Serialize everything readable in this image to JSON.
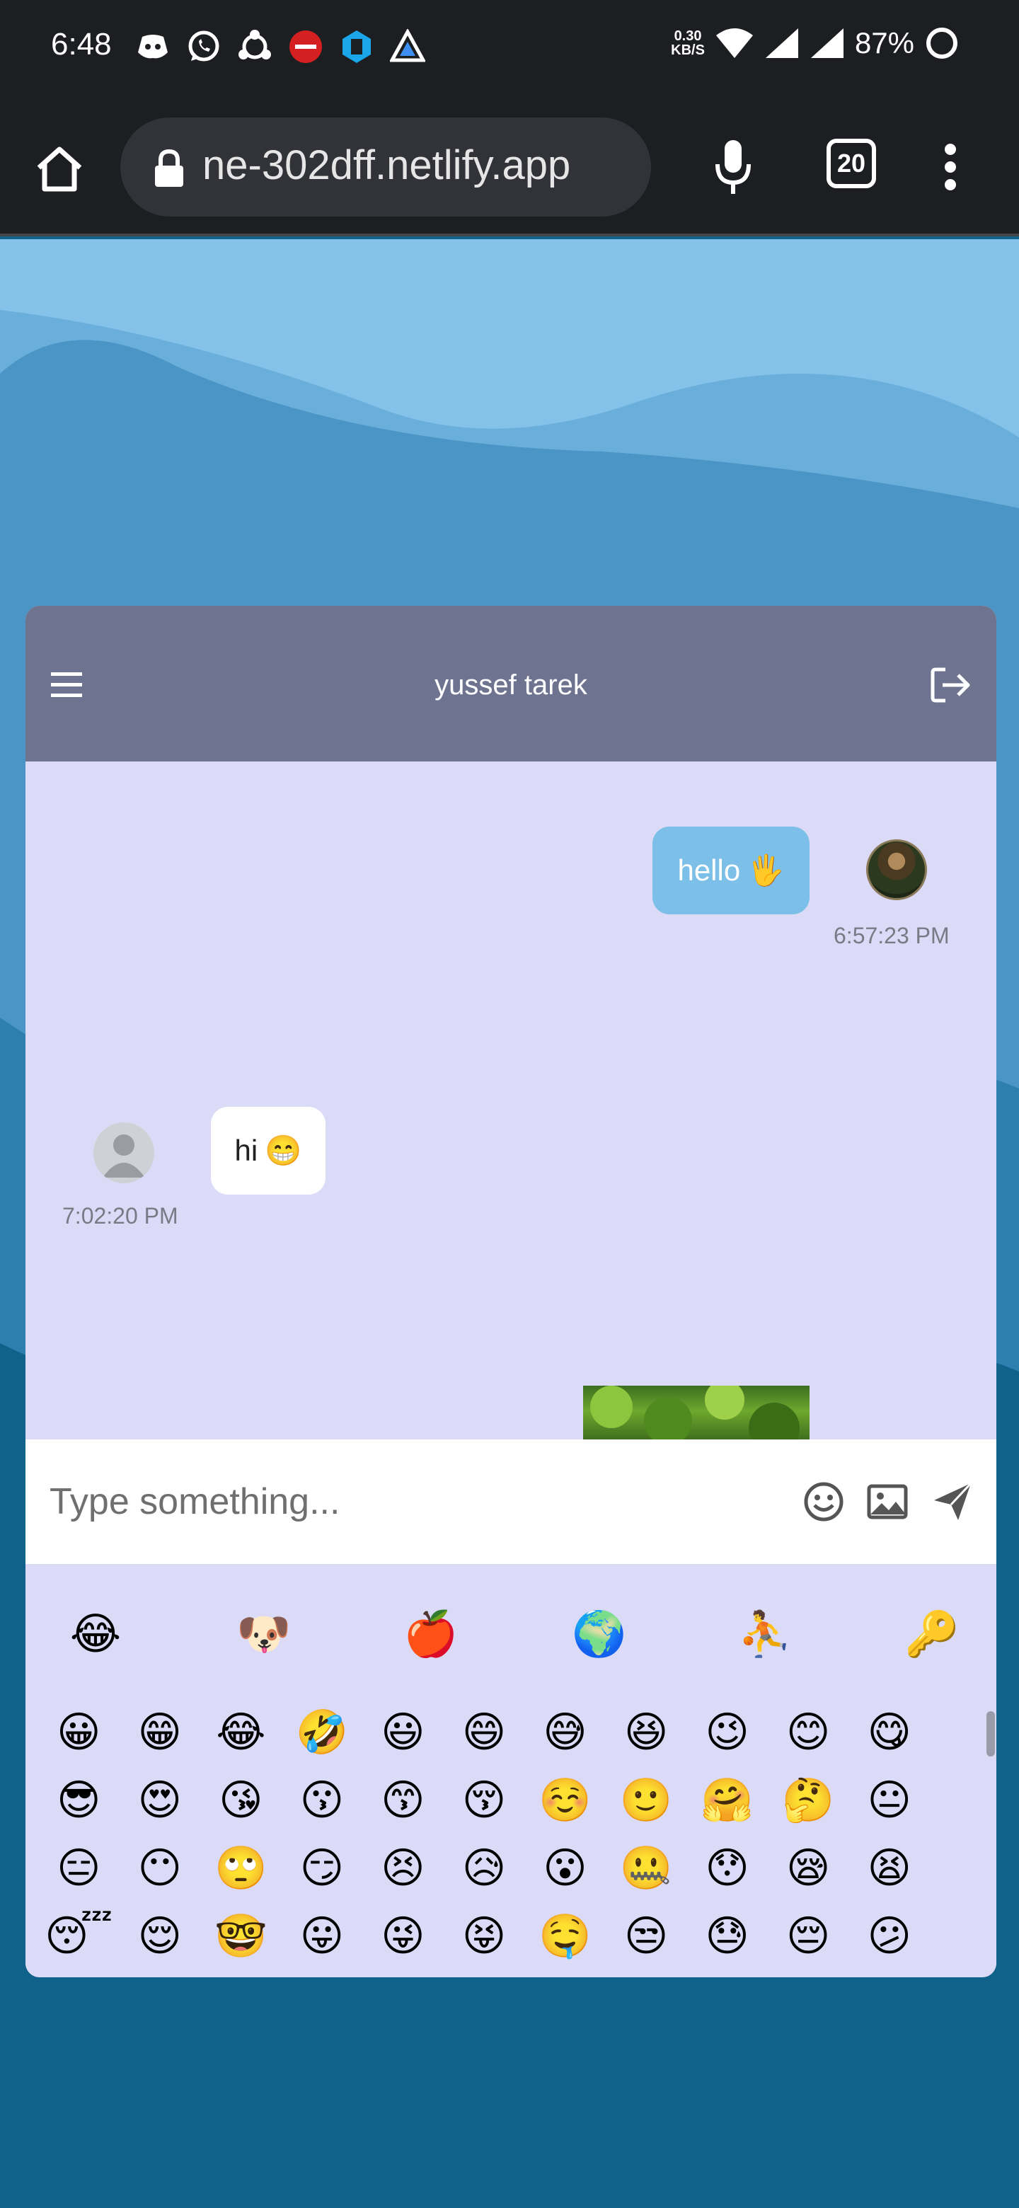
{
  "status_bar": {
    "time": "6:48",
    "net_speed_value": "0.30",
    "net_speed_unit": "KB/S",
    "battery": "87%",
    "app_icons": [
      "discord-icon",
      "whatsapp-icon",
      "share-hub-icon",
      "red-badge-icon",
      "blue-settings-icon",
      "triangle-app-icon"
    ]
  },
  "browser": {
    "url": "ne-302dff.netlify.app",
    "tab_count": "20"
  },
  "chat": {
    "title": "yussef tarek",
    "messages": [
      {
        "text": "hello",
        "emoji": "🖐️",
        "time": "6:57:23 PM",
        "sent": true
      },
      {
        "text": "hi",
        "emoji": "😁",
        "time": "7:02:20 PM",
        "sent": false
      }
    ],
    "input_placeholder": "Type something..."
  },
  "emoji_picker": {
    "categories": [
      "😂",
      "🐶",
      "🍎",
      "🌍",
      "⛹️",
      "🔑"
    ],
    "rows": [
      [
        "😀",
        "😁",
        "😂",
        "🤣",
        "😃",
        "😄",
        "😅",
        "😆",
        "😉",
        "😊",
        "😋"
      ],
      [
        "😎",
        "😍",
        "😘",
        "😗",
        "😙",
        "😚",
        "☺️",
        "🙂",
        "🤗",
        "🤔",
        "😐"
      ],
      [
        "😑",
        "😶",
        "🙄",
        "😏",
        "😣",
        "😥",
        "😮",
        "🤐",
        "😯",
        "😪",
        "😫"
      ],
      [
        "😴",
        "😌",
        "🤓",
        "😛",
        "😜",
        "😝",
        "🤤",
        "😒",
        "😓",
        "😔",
        "😕"
      ]
    ]
  },
  "colors": {
    "header": "#6e7390",
    "chat_bg": "#dcdbf7",
    "sent_bubble": "#7cbfe8",
    "page_bg": "#11628a"
  }
}
